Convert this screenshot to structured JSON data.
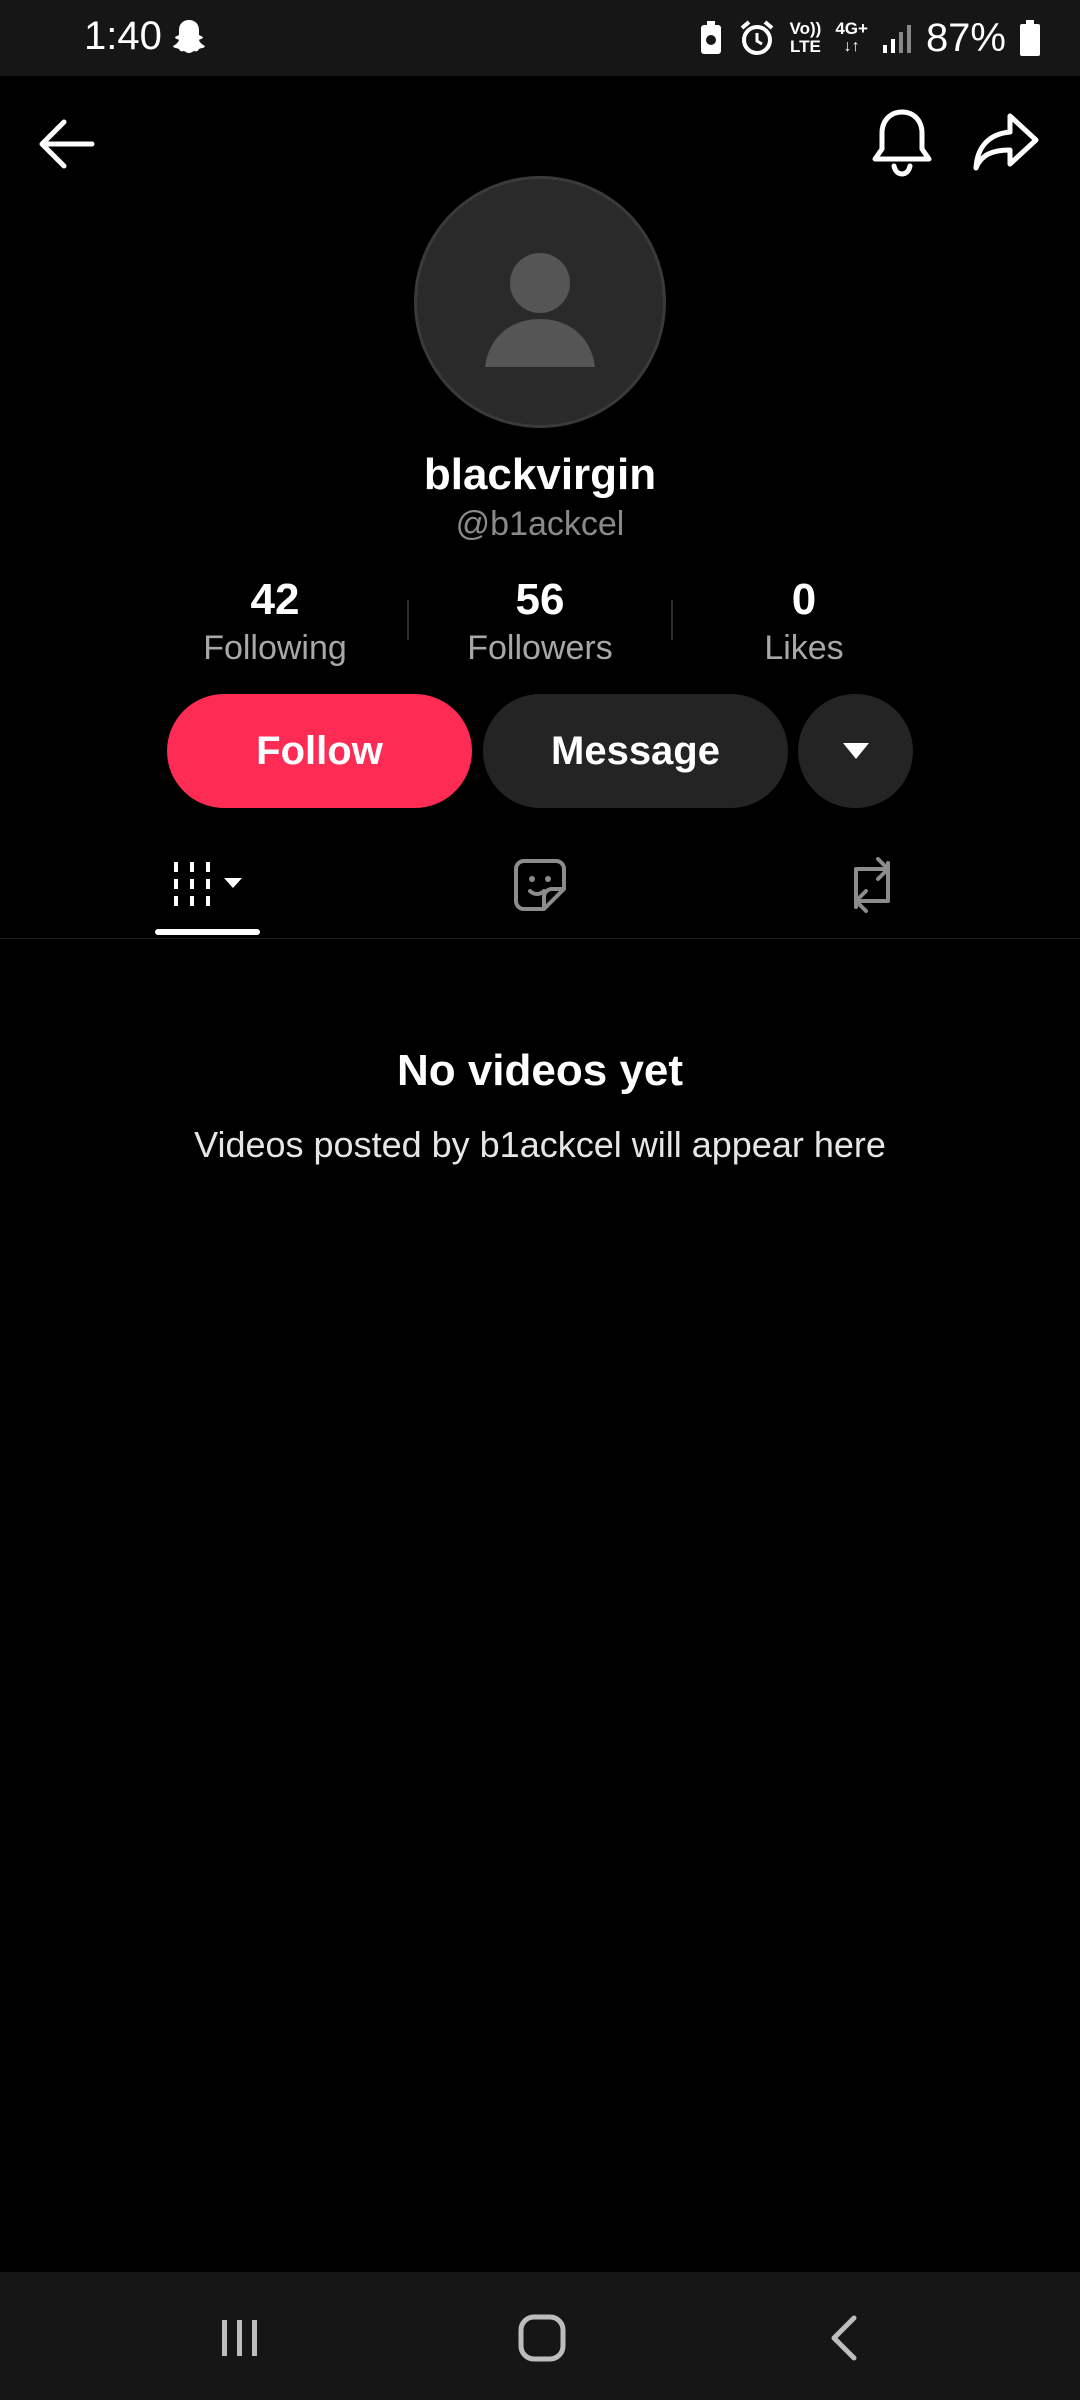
{
  "status_bar": {
    "time": "1:40",
    "icons": [
      "snapchat-ghost-icon",
      "battery-saver-icon",
      "alarm-icon",
      "volte-icon",
      "4g-data-icon",
      "signal-icon",
      "battery-icon"
    ],
    "volte_label_top": "Vo))",
    "volte_label_bottom": "LTE",
    "data_label": "4G+",
    "battery": "87%"
  },
  "header": {
    "icons": [
      "back-arrow-icon",
      "bell-icon",
      "share-icon"
    ]
  },
  "profile": {
    "display_name": "blackvirgin",
    "handle": "@b1ackcel",
    "avatar_icon": "user-icon"
  },
  "stats": [
    {
      "value": "42",
      "label": "Following"
    },
    {
      "value": "56",
      "label": "Followers"
    },
    {
      "value": "0",
      "label": "Likes"
    }
  ],
  "actions": {
    "follow": "Follow",
    "message": "Message",
    "more_icon": "caret-down-icon"
  },
  "colors": {
    "follow_button": "#fe2c55",
    "secondary_button": "#242424",
    "background": "#000000"
  },
  "tabs": [
    {
      "icon": "videos-grid-icon",
      "active": true
    },
    {
      "icon": "sticker-icon",
      "active": false
    },
    {
      "icon": "repost-icon",
      "active": false
    }
  ],
  "empty_state": {
    "title": "No videos yet",
    "subtitle": "Videos posted by b1ackcel will appear here"
  },
  "system_nav": {
    "icons": [
      "recents-icon",
      "home-icon",
      "back-icon"
    ]
  }
}
